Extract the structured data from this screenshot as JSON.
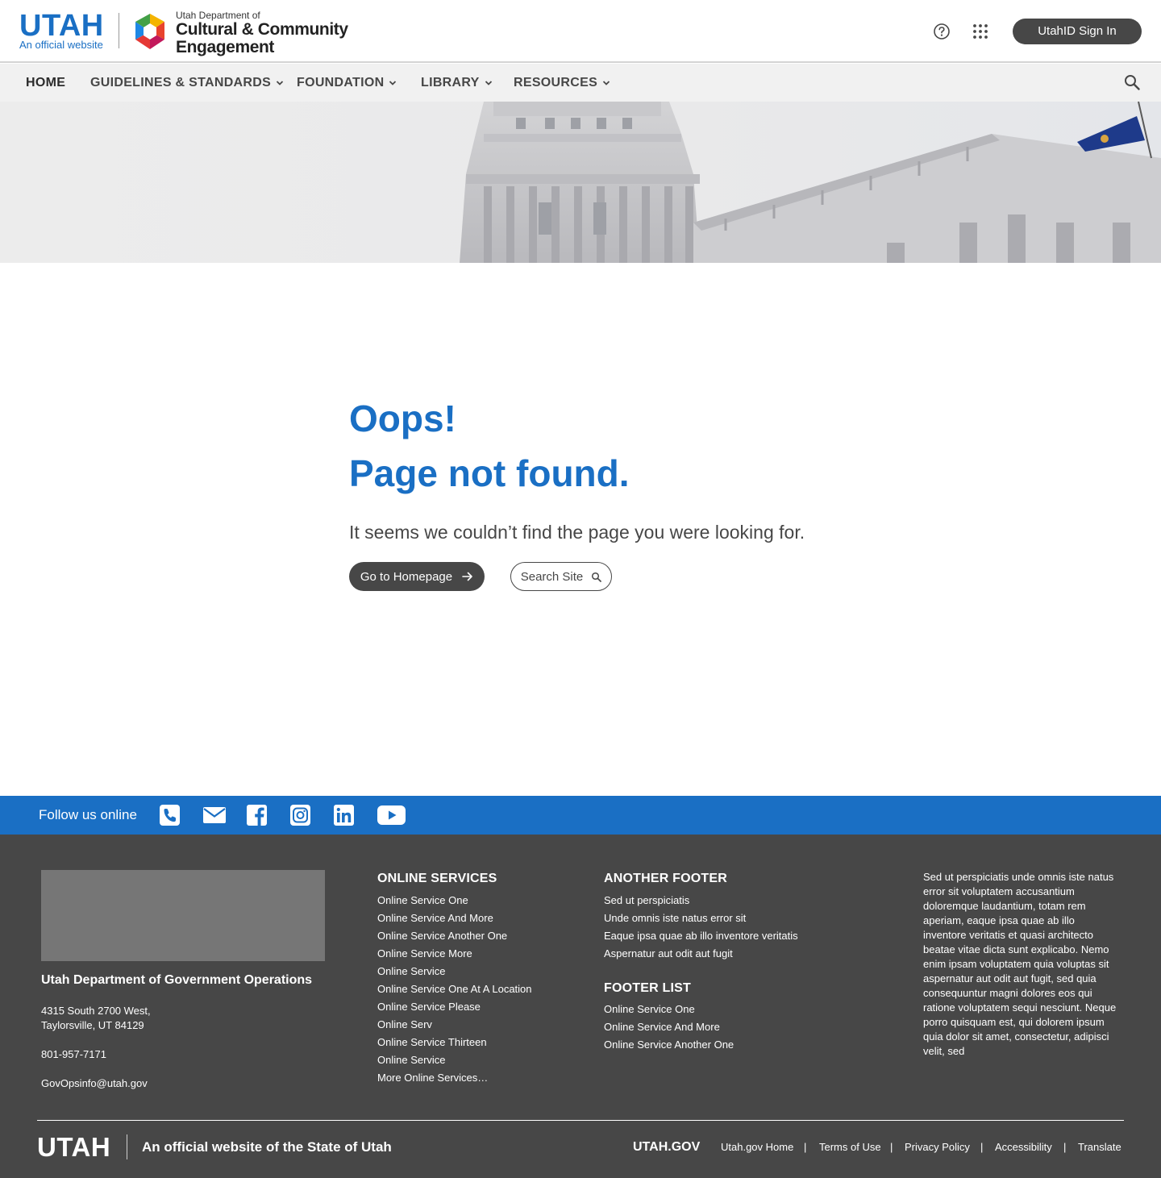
{
  "header": {
    "utah_wordmark": "UTAH",
    "official_website": "An official website",
    "agency_line1": "Utah Department of",
    "agency_line2": "Cultural & Community",
    "agency_line3": "Engagement",
    "signin_label": "UtahID Sign In",
    "icons": [
      "help-icon",
      "apps-icon"
    ]
  },
  "nav": {
    "items": [
      {
        "label": "HOME",
        "dropdown": false
      },
      {
        "label": "GUIDELINES & STANDARDS",
        "dropdown": true
      },
      {
        "label": "FOUNDATION",
        "dropdown": true
      },
      {
        "label": "LIBRARY",
        "dropdown": true
      },
      {
        "label": "RESOURCES",
        "dropdown": true
      }
    ],
    "search_icon": "search-icon"
  },
  "content": {
    "oops": "Oops!",
    "title": "Page not found.",
    "lead": "It seems we couldn’t find the page you were looking for.",
    "home_button": "Go to Homepage",
    "search_button": "Search Site"
  },
  "follow": {
    "label": "Follow us online",
    "icons": [
      "phone-icon",
      "email-icon",
      "facebook-icon",
      "instagram-icon",
      "linkedin-icon",
      "youtube-icon"
    ]
  },
  "footer": {
    "dept_name": "Utah Department of Government Operations",
    "address_line1": "4315 South 2700 West,",
    "address_line2": "Taylorsville, UT 84129",
    "phone": "801-957-7171",
    "email": "GovOpsinfo@utah.gov",
    "online_services": {
      "title": "ONLINE SERVICES",
      "items": [
        "Online Service One",
        "Online Service And More",
        "Online Service Another One",
        "Online Service More",
        "Online Service",
        "Online Service One At A Location",
        "Online Service Please",
        "Online Serv",
        "Online Service Thirteen",
        "Online Service",
        "More Online Services…"
      ]
    },
    "another_footer": {
      "title": "ANOTHER FOOTER",
      "items": [
        "Sed ut perspiciatis",
        "Unde omnis iste natus error sit",
        "Eaque ipsa quae ab illo inventore veritatis",
        "Aspernatur aut odit aut fugit"
      ]
    },
    "footer_list": {
      "title": "FOOTER LIST",
      "items": [
        "Online Service One",
        "Online Service And More",
        "Online Service Another One"
      ]
    },
    "lorem": "Sed ut perspiciatis unde omnis iste natus error sit voluptatem accusantium doloremque laudantium, totam rem aperiam, eaque ipsa quae ab illo inventore veritatis et quasi architecto beatae vitae dicta sunt explicabo. Nemo enim ipsam voluptatem quia voluptas sit aspernatur aut odit aut fugit, sed quia consequuntur magni dolores eos qui ratione voluptatem sequi nesciunt. Neque porro quisquam est, qui dolorem ipsum quia dolor sit amet, consectetur, adipisci velit, sed"
  },
  "sub_footer": {
    "utah_wordmark": "UTAH",
    "official": "An official website of the State of Utah",
    "utah_gov": "UTAH.GOV",
    "links": [
      "Utah.gov Home",
      "Terms of Use",
      "Privacy Policy",
      "Accessibility",
      "Translate"
    ],
    "separator": "|"
  },
  "colors": {
    "brand_blue": "#1a6fc4",
    "dark_gray": "#474747",
    "nav_bg": "#f1f1f1",
    "placeholder_gray": "#767676"
  }
}
